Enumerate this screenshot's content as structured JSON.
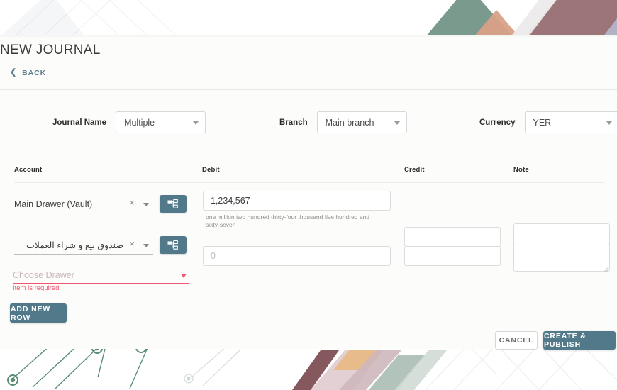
{
  "header": {
    "title": "NEW JOURNAL",
    "back_label": "BACK",
    "back_icon": "chevron-left-icon"
  },
  "filters": [
    {
      "label": "Journal Name",
      "value": "Multiple",
      "name": "journal-name"
    },
    {
      "label": "Branch",
      "value": "Main branch",
      "name": "branch"
    },
    {
      "label": "Currency",
      "value": "YER",
      "name": "currency"
    }
  ],
  "table": {
    "columns": [
      "Account",
      "Debit",
      "Credit",
      "Note"
    ],
    "rows": [
      {
        "account": "Main Drawer (Vault)",
        "account_rtl": false,
        "debit_value": "1,234,567",
        "debit_placeholder": "",
        "debit_hint": "one million two hundred thirty-four thousand five hundred and sixty-seven",
        "credit_value": "",
        "credit_placeholder": "",
        "note_value": "",
        "note_placeholder": ""
      },
      {
        "account": "صندوق بيع و شراء العملات",
        "account_rtl": true,
        "debit_value": "",
        "debit_placeholder": "0",
        "debit_hint": "",
        "credit_value": "",
        "credit_placeholder": "",
        "note_value": "",
        "note_placeholder": ""
      }
    ],
    "clear_icon": "×",
    "tree_icon": "sitemap-icon"
  },
  "drawer_select": {
    "placeholder": "Choose Drawer",
    "error": "Item is required"
  },
  "actions": {
    "add_row": "ADD NEW ROW",
    "cancel": "CANCEL",
    "publish": "CREATE & PUBLISH"
  },
  "colors": {
    "accent": "#51798a",
    "error": "#f2556f",
    "card": "#fcfcfb",
    "deco_green": "#6f9184",
    "deco_maroon": "#8e6267",
    "deco_peach": "#d9a188",
    "deco_pink": "#e2cdd2"
  }
}
